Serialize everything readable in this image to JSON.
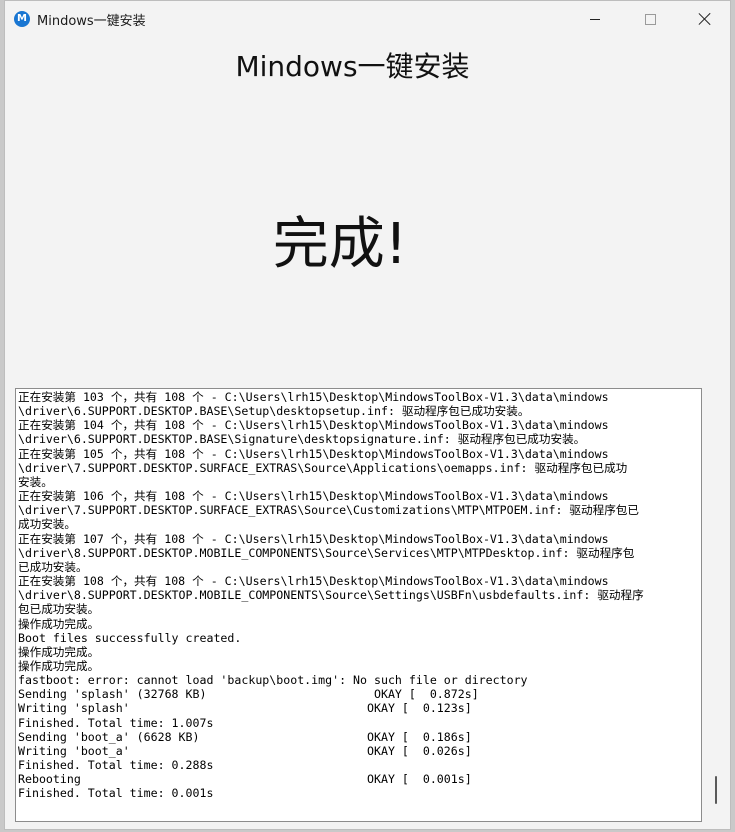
{
  "window": {
    "title": "Mindows一键安装",
    "app_icon_letter": "M"
  },
  "main": {
    "heading": "Mindows一键安装",
    "status": "完成!"
  },
  "log": {
    "lines": [
      "正在安装第 103 个，共有 108 个 - C:\\Users\\lrh15\\Desktop\\MindowsToolBox-V1.3\\data\\mindows",
      "\\driver\\6.SUPPORT.DESKTOP.BASE\\Setup\\desktopsetup.inf: 驱动程序包已成功安装。",
      "正在安装第 104 个，共有 108 个 - C:\\Users\\lrh15\\Desktop\\MindowsToolBox-V1.3\\data\\mindows",
      "\\driver\\6.SUPPORT.DESKTOP.BASE\\Signature\\desktopsignature.inf: 驱动程序包已成功安装。",
      "正在安装第 105 个，共有 108 个 - C:\\Users\\lrh15\\Desktop\\MindowsToolBox-V1.3\\data\\mindows",
      "\\driver\\7.SUPPORT.DESKTOP.SURFACE_EXTRAS\\Source\\Applications\\oemapps.inf: 驱动程序包已成功",
      "安装。",
      "正在安装第 106 个，共有 108 个 - C:\\Users\\lrh15\\Desktop\\MindowsToolBox-V1.3\\data\\mindows",
      "\\driver\\7.SUPPORT.DESKTOP.SURFACE_EXTRAS\\Source\\Customizations\\MTP\\MTPOEM.inf: 驱动程序包已",
      "成功安装。",
      "正在安装第 107 个，共有 108 个 - C:\\Users\\lrh15\\Desktop\\MindowsToolBox-V1.3\\data\\mindows",
      "\\driver\\8.SUPPORT.DESKTOP.MOBILE_COMPONENTS\\Source\\Services\\MTP\\MTPDesktop.inf: 驱动程序包",
      "已成功安装。",
      "正在安装第 108 个，共有 108 个 - C:\\Users\\lrh15\\Desktop\\MindowsToolBox-V1.3\\data\\mindows",
      "\\driver\\8.SUPPORT.DESKTOP.MOBILE_COMPONENTS\\Source\\Settings\\USBFn\\usbdefaults.inf: 驱动程序",
      "包已成功安装。",
      "操作成功完成。",
      "Boot files successfully created.",
      "操作成功完成。",
      "操作成功完成。",
      "fastboot: error: cannot load 'backup\\boot.img': No such file or directory",
      "Sending 'splash' (32768 KB)                        OKAY [  0.872s]",
      "Writing 'splash'                                  OKAY [  0.123s]",
      "Finished. Total time: 1.007s",
      "Sending 'boot_a' (6628 KB)                        OKAY [  0.186s]",
      "Writing 'boot_a'                                  OKAY [  0.026s]",
      "Finished. Total time: 0.288s",
      "Rebooting                                         OKAY [  0.001s]",
      "Finished. Total time: 0.001s"
    ]
  }
}
